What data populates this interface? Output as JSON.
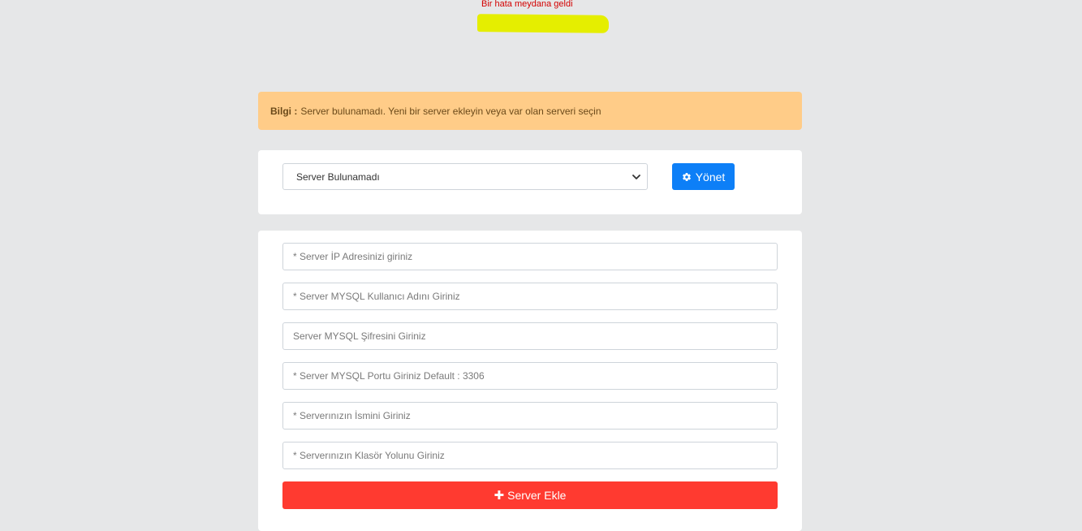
{
  "error": {
    "message": "Bir hata meydana geldi"
  },
  "alert": {
    "label": "Bilgi :",
    "text": "Server bulunamadı. Yeni bir server ekleyin veya var olan serveri seçin"
  },
  "server_select": {
    "selected": "Server Bulunamadı"
  },
  "manage_button": {
    "label": "Yönet",
    "icon": "gear-icon"
  },
  "form": {
    "fields": [
      {
        "placeholder": "* Server İP Adresinizi giriniz"
      },
      {
        "placeholder": "* Server MYSQL Kullanıcı Adını Giriniz"
      },
      {
        "placeholder": "Server MYSQL Şifresini Giriniz"
      },
      {
        "placeholder": "* Server MYSQL Portu Giriniz Default : 3306"
      },
      {
        "placeholder": "* Serverınızın İsmini Giriniz"
      },
      {
        "placeholder": "* Serverınızın Klasör Yolunu Giriniz"
      }
    ],
    "submit_label": "Server Ekle",
    "submit_icon": "plus-icon"
  },
  "colors": {
    "background": "#e6e7e8",
    "alert_bg": "#ffcc88",
    "primary": "#0d7ff7",
    "danger": "#ff3a30",
    "error_text": "#d30000",
    "highlight": "#e5ee00"
  }
}
